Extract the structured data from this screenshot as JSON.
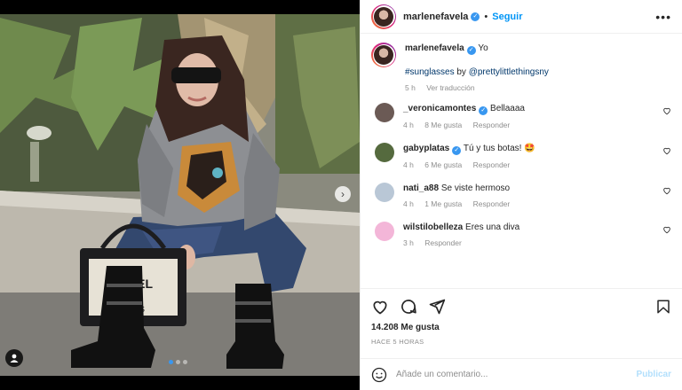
{
  "post": {
    "author": "marlenefavela",
    "follow_label": "Seguir",
    "separator": "•",
    "more_label": "•••",
    "caption_text": "Yo",
    "caption_hashtag": "#sunglasses",
    "caption_by": " by ",
    "caption_mention": "@prettylittlethingsny",
    "caption_age": "5 h",
    "see_translation": "Ver traducción"
  },
  "comments": [
    {
      "user": "_veronicamontes",
      "verified": true,
      "text": "Bellaaaa",
      "age": "4 h",
      "likes": "8 Me gusta",
      "reply": "Responder",
      "avatar_color": "#6b5a55"
    },
    {
      "user": "gabyplatas",
      "verified": true,
      "text": "Tú y tus botas! 🤩",
      "age": "4 h",
      "likes": "6 Me gusta",
      "reply": "Responder",
      "avatar_color": "#556a3e"
    },
    {
      "user": "nati_a88",
      "verified": false,
      "text": "Se viste hermoso",
      "age": "4 h",
      "likes": "1 Me gusta",
      "reply": "Responder",
      "avatar_color": "#b9c7d6"
    },
    {
      "user": "wilstilobelleza",
      "verified": false,
      "text": "Eres una diva",
      "age": "3 h",
      "likes": "",
      "reply": "Responder",
      "avatar_color": "#f3b6d8"
    }
  ],
  "stats": {
    "likes": "14.208 Me gusta",
    "time": "HACE 5 HORAS"
  },
  "composer": {
    "placeholder": "Añade un comentario...",
    "publish_label": "Publicar"
  },
  "carousel": {
    "slide_count": 3,
    "active_index": 0
  },
  "icons": {
    "like": "heart-icon",
    "comment": "comment-icon",
    "share": "send-icon",
    "save": "bookmark-icon",
    "emoji": "smiley-icon",
    "next": "chevron-right-icon",
    "tag": "user-tag-icon"
  },
  "colors": {
    "accent": "#0095f6",
    "link": "#00376b",
    "muted": "#8e8e8e",
    "publish_disabled": "#b2dffc"
  }
}
